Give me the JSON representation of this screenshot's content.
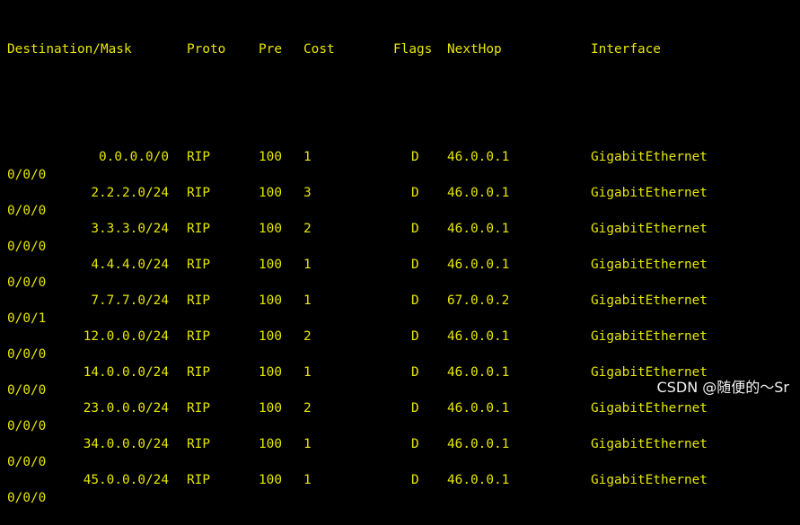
{
  "terminal": {
    "header": {
      "destination": "Destination/Mask",
      "proto": "Proto",
      "pre": "Pre",
      "cost": "Cost",
      "flags": "Flags",
      "nexthop": "NextHop",
      "interface": "Interface"
    },
    "routes": [
      {
        "destination": "0.0.0.0/0",
        "proto": "RIP",
        "pre": "100",
        "cost": "1",
        "flags": "D",
        "nexthop": "46.0.0.1",
        "interface": "GigabitEthernet",
        "interface_cont": "0/0/0"
      },
      {
        "destination": "2.2.2.0/24",
        "proto": "RIP",
        "pre": "100",
        "cost": "3",
        "flags": "D",
        "nexthop": "46.0.0.1",
        "interface": "GigabitEthernet",
        "interface_cont": "0/0/0"
      },
      {
        "destination": "3.3.3.0/24",
        "proto": "RIP",
        "pre": "100",
        "cost": "2",
        "flags": "D",
        "nexthop": "46.0.0.1",
        "interface": "GigabitEthernet",
        "interface_cont": "0/0/0"
      },
      {
        "destination": "4.4.4.0/24",
        "proto": "RIP",
        "pre": "100",
        "cost": "1",
        "flags": "D",
        "nexthop": "46.0.0.1",
        "interface": "GigabitEthernet",
        "interface_cont": "0/0/0"
      },
      {
        "destination": "7.7.7.0/24",
        "proto": "RIP",
        "pre": "100",
        "cost": "1",
        "flags": "D",
        "nexthop": "67.0.0.2",
        "interface": "GigabitEthernet",
        "interface_cont": "0/0/1"
      },
      {
        "destination": "12.0.0.0/24",
        "proto": "RIP",
        "pre": "100",
        "cost": "2",
        "flags": "D",
        "nexthop": "46.0.0.1",
        "interface": "GigabitEthernet",
        "interface_cont": "0/0/0"
      },
      {
        "destination": "14.0.0.0/24",
        "proto": "RIP",
        "pre": "100",
        "cost": "1",
        "flags": "D",
        "nexthop": "46.0.0.1",
        "interface": "GigabitEthernet",
        "interface_cont": "0/0/0"
      },
      {
        "destination": "23.0.0.0/24",
        "proto": "RIP",
        "pre": "100",
        "cost": "2",
        "flags": "D",
        "nexthop": "46.0.0.1",
        "interface": "GigabitEthernet",
        "interface_cont": "0/0/0"
      },
      {
        "destination": "34.0.0.0/24",
        "proto": "RIP",
        "pre": "100",
        "cost": "1",
        "flags": "D",
        "nexthop": "46.0.0.1",
        "interface": "GigabitEthernet",
        "interface_cont": "0/0/0"
      },
      {
        "destination": "45.0.0.0/24",
        "proto": "RIP",
        "pre": "100",
        "cost": "1",
        "flags": "D",
        "nexthop": "46.0.0.1",
        "interface": "GigabitEthernet",
        "interface_cont": "0/0/0"
      }
    ],
    "text_color": "#e6e600",
    "background_color": "#000000"
  },
  "watermark": "CSDN @随便的～Sr"
}
